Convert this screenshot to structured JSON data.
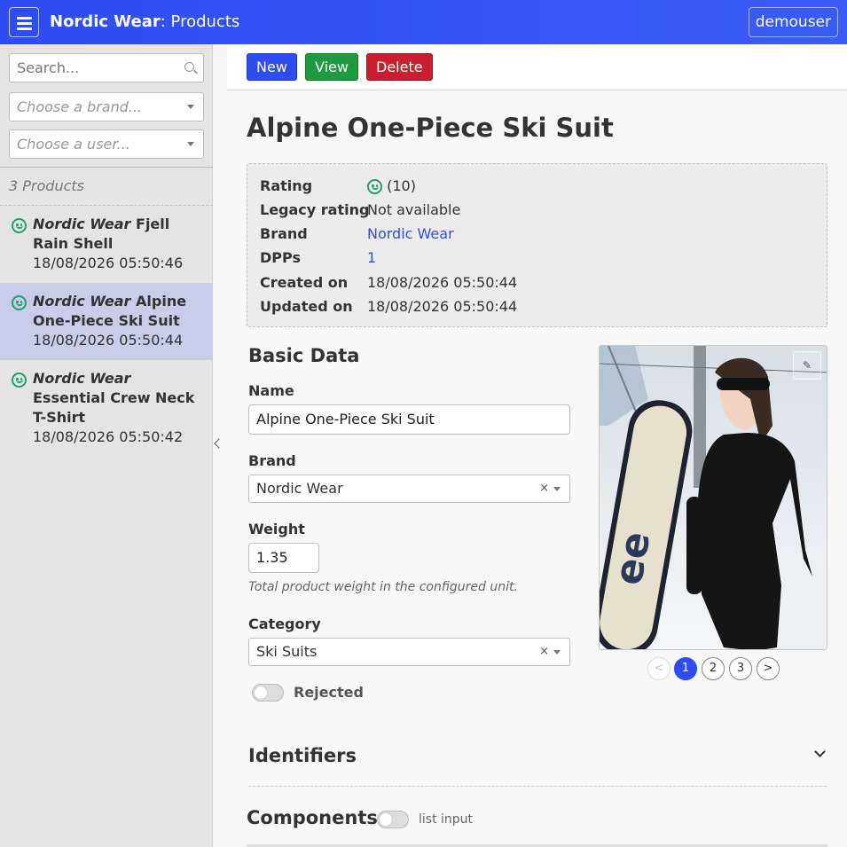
{
  "header": {
    "brand": "Nordic Wear",
    "section": ": Products",
    "user": "demouser"
  },
  "sidebar": {
    "search_placeholder": "Search...",
    "brand_placeholder": "Choose a brand...",
    "user_placeholder": "Choose a user...",
    "count": "3 Products",
    "items": [
      {
        "brand": "Nordic Wear",
        "name": " Fjell Rain Shell",
        "date": "18/08/2026 05:50:46"
      },
      {
        "brand": "Nordic Wear",
        "name": " Alpine One-Piece Ski Suit",
        "date": "18/08/2026 05:50:44"
      },
      {
        "brand": "Nordic Wear",
        "name": " Essential Crew Neck T-Shirt",
        "date": "18/08/2026 05:50:42"
      }
    ]
  },
  "toolbar": {
    "new_label": "New",
    "view_label": "View",
    "delete_label": "Delete"
  },
  "product": {
    "title": "Alpine One-Piece Ski Suit",
    "info": {
      "rating_label": "Rating",
      "rating_value": "(10)",
      "legacy_label": "Legacy rating",
      "legacy_value": "Not available",
      "brand_label": "Brand",
      "brand_value": "Nordic Wear",
      "dpps_label": "DPPs",
      "dpps_value": "1",
      "created_label": "Created on",
      "created_value": "18/08/2026 05:50:44",
      "updated_label": "Updated on",
      "updated_value": "18/08/2026 05:50:44"
    }
  },
  "form": {
    "section_title": "Basic Data",
    "name_label": "Name",
    "name_value": "Alpine One-Piece Ski Suit",
    "brand_label": "Brand",
    "brand_value": "Nordic Wear",
    "weight_label": "Weight",
    "weight_value": "1.35",
    "weight_hint": "Total product weight in the configured unit.",
    "category_label": "Category",
    "category_value": "Ski Suits",
    "rejected_label": "Rejected",
    "clear_glyph": "×"
  },
  "gallery": {
    "prev": "<",
    "pages": [
      "1",
      "2",
      "3"
    ],
    "next": ">",
    "current_page": "1"
  },
  "sections": {
    "identifiers": "Identifiers",
    "components": "Components",
    "list_input": "list input"
  },
  "colors": {
    "primary": "#2f4cf2",
    "success": "#1f9a3f",
    "danger": "#c81e2e",
    "rating": "#22a06b"
  }
}
